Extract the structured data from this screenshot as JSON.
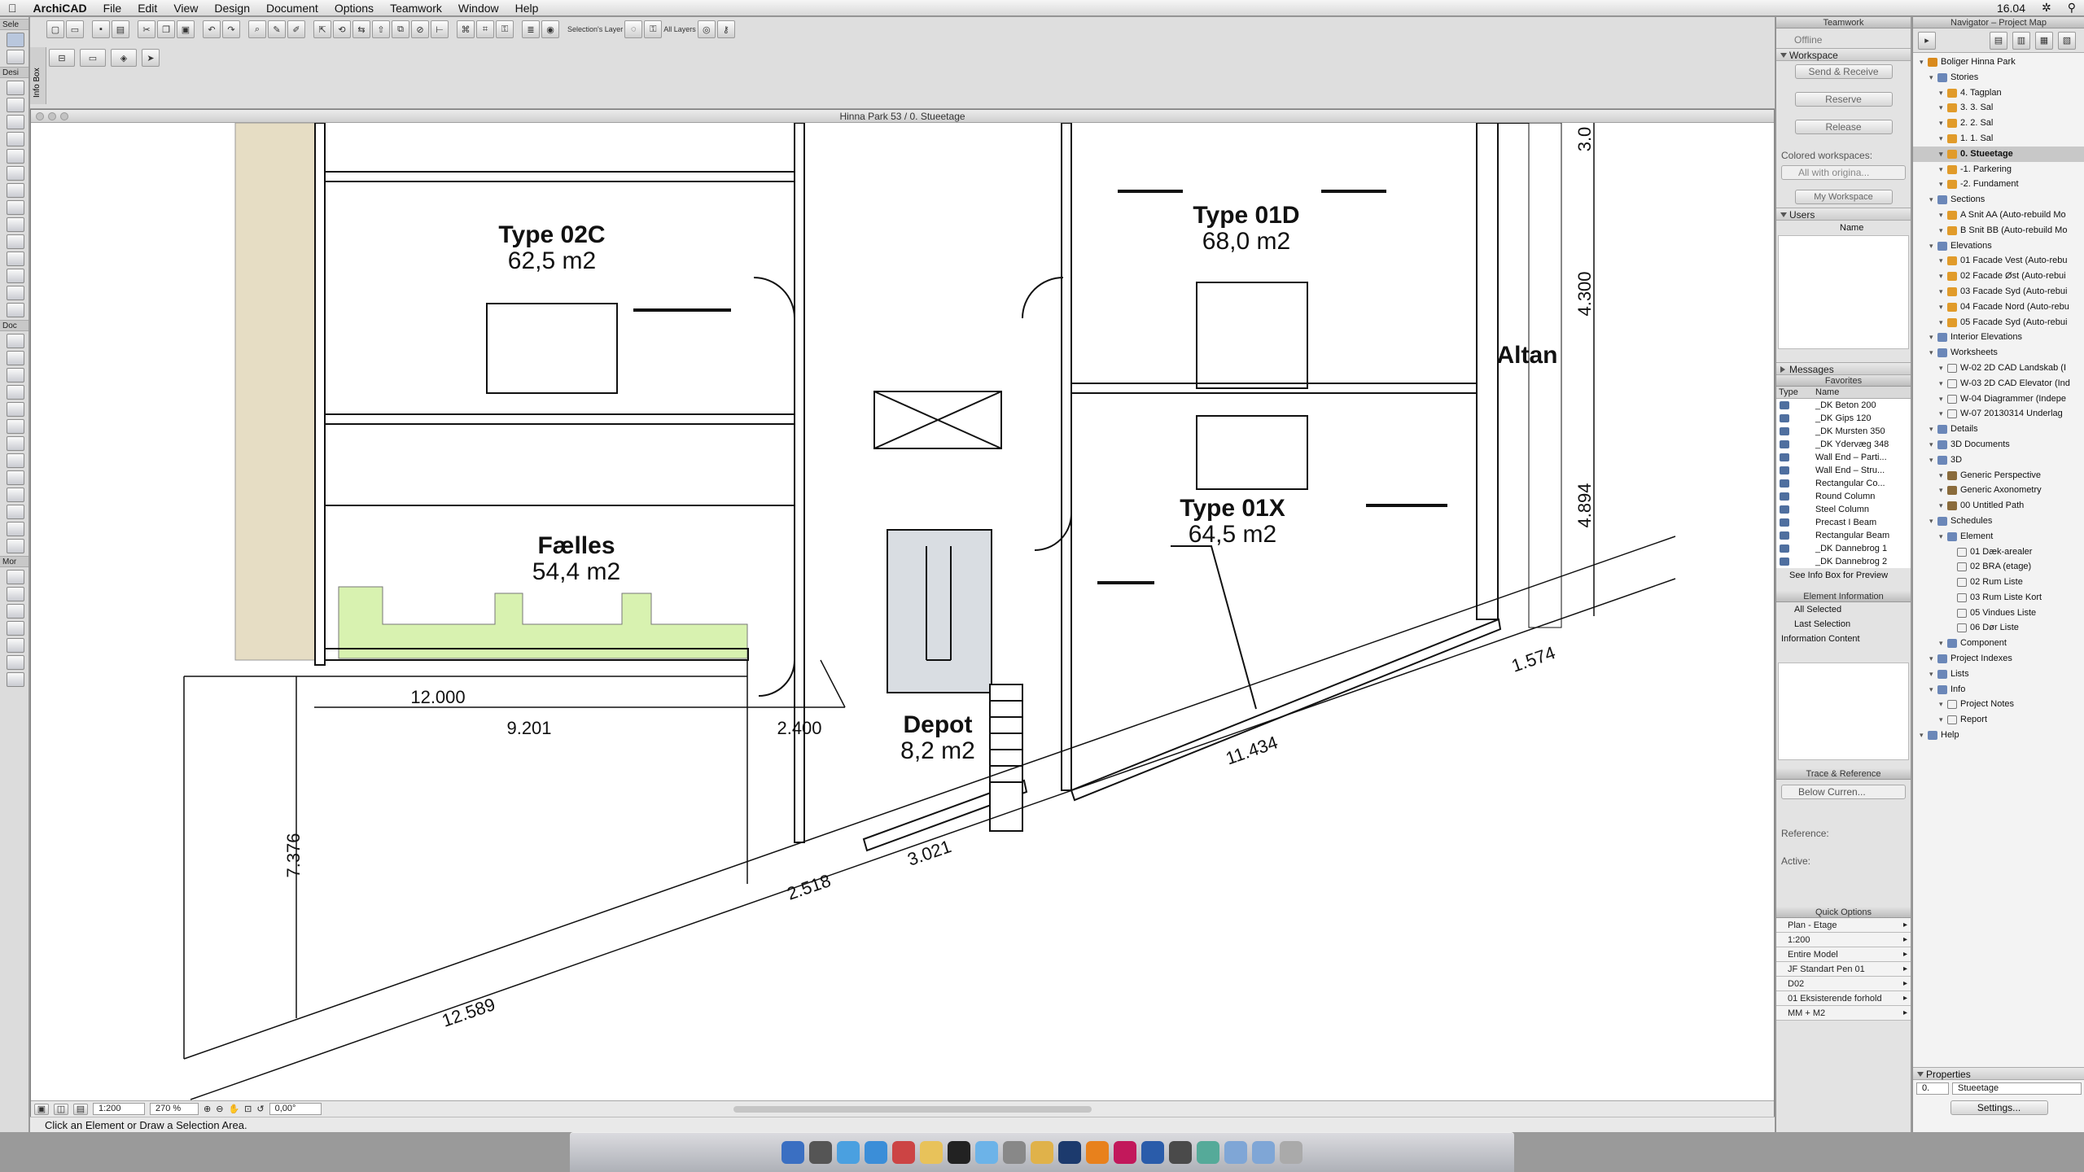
{
  "menubar": {
    "app": "ArchiCAD",
    "items": [
      "File",
      "Edit",
      "View",
      "Design",
      "Document",
      "Options",
      "Teamwork",
      "Window",
      "Help"
    ],
    "clock": "16.04"
  },
  "toolbox": {
    "captions": [
      "Sele",
      "Desi",
      "Doc",
      "Mor"
    ]
  },
  "toolbar": {
    "selections_layer_label": "Selection's Layer",
    "all_layers_label": "All Layers"
  },
  "infobox": {
    "strip_label": "Info Box"
  },
  "document": {
    "title": "Hinna Park 53 / 0. Stueetage",
    "scale": "1:200",
    "zoom": "270 %",
    "angle": "0,00°",
    "hint": "Click an Element or Draw a Selection Area."
  },
  "plan": {
    "rooms": [
      {
        "name": "Type 02C",
        "area": "62,5 m2"
      },
      {
        "name": "Type 01D",
        "area": "68,0 m2"
      },
      {
        "name": "Fælles",
        "area": "54,4 m2"
      },
      {
        "name": "Type 01X",
        "area": "64,5 m2"
      },
      {
        "name": "Depot",
        "area": "8,2 m2"
      }
    ],
    "altan_label": "Altan",
    "dimensions": [
      "12.000",
      "9.201",
      "2.400",
      "7.376",
      "2.518",
      "3.021",
      "11.434",
      "1.574",
      "12.589",
      "4.300",
      "4.894",
      "3.0"
    ]
  },
  "teamwork": {
    "title": "Teamwork",
    "status": "Offline",
    "workspace_label": "Workspace",
    "send_receive": "Send & Receive",
    "reserve": "Reserve",
    "release": "Release",
    "colored_workspaces_label": "Colored workspaces:",
    "colored_workspaces_value": "All with origina...",
    "my_workspace": "My Workspace",
    "users_label": "Users",
    "users_col": "Name",
    "messages_label": "Messages"
  },
  "favorites": {
    "title": "Favorites",
    "col_type": "Type",
    "col_name": "Name",
    "items": [
      "_DK Beton 200",
      "_DK Gips 120",
      "_DK Mursten 350",
      "_DK Ydervæg 348",
      "Wall End – Parti...",
      "Wall End – Stru...",
      "Rectangular Co...",
      "Round Column",
      "Steel Column",
      "Precast I Beam",
      "Rectangular Beam",
      "_DK Dannebrog 1",
      "_DK Dannebrog 2"
    ],
    "preview_hint": "See Info Box for Preview"
  },
  "element_info": {
    "title": "Element Information",
    "all_selected": "All Selected",
    "last_selection": "Last Selection",
    "info_content": "Information Content"
  },
  "trace": {
    "title": "Trace & Reference",
    "value": "Below Curren...",
    "reference_label": "Reference:",
    "active_label": "Active:"
  },
  "quick_options": {
    "title": "Quick Options",
    "rows": [
      "Plan - Etage",
      "1:200",
      "Entire Model",
      "JF Standart Pen 01",
      "D02",
      "01 Eksisterende forhold",
      "MM + M2"
    ]
  },
  "navigator": {
    "title": "Navigator – Project Map",
    "tree": [
      {
        "label": "Boliger Hinna Park",
        "level": 0,
        "icon": "root"
      },
      {
        "label": "Stories",
        "level": 1,
        "icon": "doc"
      },
      {
        "label": "4. Tagplan",
        "level": 2,
        "icon": "house"
      },
      {
        "label": "3. 3. Sal",
        "level": 2,
        "icon": "house"
      },
      {
        "label": "2. 2. Sal",
        "level": 2,
        "icon": "house"
      },
      {
        "label": "1. 1. Sal",
        "level": 2,
        "icon": "house"
      },
      {
        "label": "0. Stueetage",
        "level": 2,
        "icon": "house",
        "selected": true
      },
      {
        "label": "-1. Parkering",
        "level": 2,
        "icon": "house"
      },
      {
        "label": "-2. Fundament",
        "level": 2,
        "icon": "house"
      },
      {
        "label": "Sections",
        "level": 1,
        "icon": "doc"
      },
      {
        "label": "A Snit AA (Auto-rebuild Mo",
        "level": 2,
        "icon": "house"
      },
      {
        "label": "B Snit BB (Auto-rebuild Mo",
        "level": 2,
        "icon": "house"
      },
      {
        "label": "Elevations",
        "level": 1,
        "icon": "doc"
      },
      {
        "label": "01 Facade Vest (Auto-rebu",
        "level": 2,
        "icon": "house"
      },
      {
        "label": "02 Facade Øst (Auto-rebui",
        "level": 2,
        "icon": "house"
      },
      {
        "label": "03 Facade Syd (Auto-rebui",
        "level": 2,
        "icon": "house"
      },
      {
        "label": "04 Facade Nord (Auto-rebu",
        "level": 2,
        "icon": "house"
      },
      {
        "label": "05 Facade Syd (Auto-rebui",
        "level": 2,
        "icon": "house"
      },
      {
        "label": "Interior Elevations",
        "level": 1,
        "icon": "doc"
      },
      {
        "label": "Worksheets",
        "level": 1,
        "icon": "doc"
      },
      {
        "label": "W-02 2D CAD Landskab (I",
        "level": 2,
        "icon": "sheet"
      },
      {
        "label": "W-03 2D CAD Elevator (Ind",
        "level": 2,
        "icon": "sheet"
      },
      {
        "label": "W-04 Diagrammer (Indepe",
        "level": 2,
        "icon": "sheet"
      },
      {
        "label": "W-07 20130314 Underlag",
        "level": 2,
        "icon": "sheet"
      },
      {
        "label": "Details",
        "level": 1,
        "icon": "doc"
      },
      {
        "label": "3D Documents",
        "level": 1,
        "icon": "doc"
      },
      {
        "label": "3D",
        "level": 1,
        "icon": "doc"
      },
      {
        "label": "Generic Perspective",
        "level": 2,
        "icon": "3d"
      },
      {
        "label": "Generic Axonometry",
        "level": 2,
        "icon": "3d"
      },
      {
        "label": "00 Untitled Path",
        "level": 2,
        "icon": "3d"
      },
      {
        "label": "Schedules",
        "level": 1,
        "icon": "doc"
      },
      {
        "label": "Element",
        "level": 2,
        "icon": "doc"
      },
      {
        "label": "01 Dæk-arealer",
        "level": 3,
        "icon": "sheet"
      },
      {
        "label": "02 BRA (etage)",
        "level": 3,
        "icon": "sheet"
      },
      {
        "label": "02 Rum Liste",
        "level": 3,
        "icon": "sheet"
      },
      {
        "label": "03 Rum Liste Kort",
        "level": 3,
        "icon": "sheet"
      },
      {
        "label": "05 Vindues Liste",
        "level": 3,
        "icon": "sheet"
      },
      {
        "label": "06 Dør Liste",
        "level": 3,
        "icon": "sheet"
      },
      {
        "label": "Component",
        "level": 2,
        "icon": "doc"
      },
      {
        "label": "Project Indexes",
        "level": 1,
        "icon": "doc"
      },
      {
        "label": "Lists",
        "level": 1,
        "icon": "doc"
      },
      {
        "label": "Info",
        "level": 1,
        "icon": "doc"
      },
      {
        "label": "Project Notes",
        "level": 2,
        "icon": "sheet"
      },
      {
        "label": "Report",
        "level": 2,
        "icon": "sheet"
      },
      {
        "label": "Help",
        "level": 0,
        "icon": "doc"
      }
    ],
    "properties_label": "Properties",
    "prop_id": "0.",
    "prop_name": "Stueetage",
    "settings_btn": "Settings..."
  },
  "colors": {
    "accent_green": "#d8f2b0",
    "column_tan": "#e6ddc4",
    "stair_gray": "#d9dde2"
  }
}
